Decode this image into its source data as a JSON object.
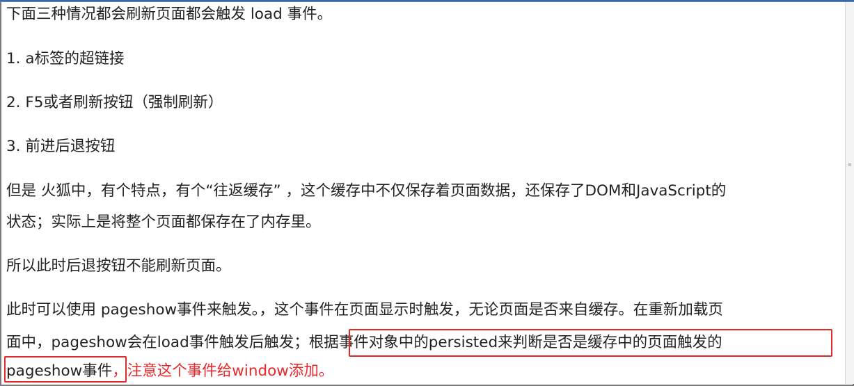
{
  "paragraphs": {
    "intro": "下面三种情况都会刷新页面都会触发 load 事件。",
    "item1": "1.   a标签的超链接",
    "item2": "2.   F5或者刷新按钮（强制刷新）",
    "item3": "3.   前进后退按钮",
    "firefox_line1": "但是 火狐中，有个特点，有个“往返缓存” ，这个缓存中不仅保存着页面数据，还保存了DOM和JavaScript的",
    "firefox_line2": "状态；实际上是将整个页面都保存在了内存里。",
    "back_button": "所以此时后退按钮不能刷新页面。",
    "pageshow_line1": "此时可以使用 pageshow事件来触发。，这个事件在页面显示时触发，无论页面是否来自缓存。在重新加载页",
    "pageshow_line2a": "面中，pageshow会在load事件触发后触发；",
    "pageshow_line2b": "根据事件对象中的persisted来判断是否是缓存中的页面触发的",
    "pageshow_line3a": "pageshow事件",
    "pageshow_line3b": "，注意这个事件给window添加。"
  },
  "colors": {
    "text": "#222222",
    "highlight_red": "#e8272b",
    "box_border": "#e02a2a"
  }
}
